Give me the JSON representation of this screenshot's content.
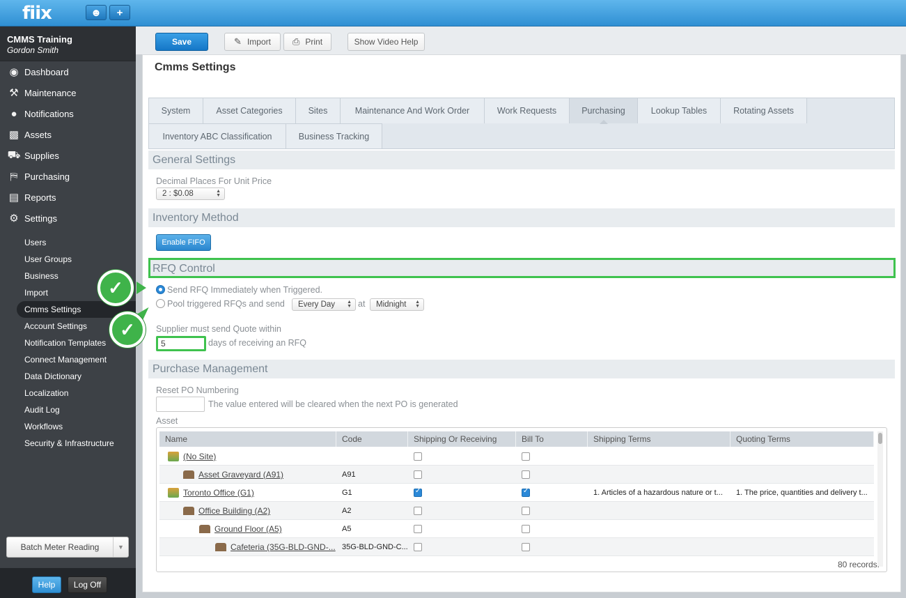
{
  "app": {
    "logo": "fiix"
  },
  "topbar": {
    "user_icon": "user-icon",
    "add_icon": "plus-icon"
  },
  "account": {
    "org": "CMMS Training",
    "user": "Gordon Smith"
  },
  "nav": [
    {
      "label": "Dashboard",
      "icon": "dashboard-icon"
    },
    {
      "label": "Maintenance",
      "icon": "tools-icon"
    },
    {
      "label": "Notifications",
      "icon": "chat-icon"
    },
    {
      "label": "Assets",
      "icon": "box-icon"
    },
    {
      "label": "Supplies",
      "icon": "truck-icon"
    },
    {
      "label": "Purchasing",
      "icon": "cart-icon"
    },
    {
      "label": "Reports",
      "icon": "chart-icon"
    },
    {
      "label": "Settings",
      "icon": "gear-icon"
    }
  ],
  "settings_sub": [
    "Users",
    "User Groups",
    "Business",
    "Import",
    "Cmms Settings",
    "Account Settings",
    "Notification Templates",
    "Connect Management",
    "Data Dictionary",
    "Localization",
    "Audit Log",
    "Workflows",
    "Security & Infrastructure"
  ],
  "sidebar_bottom": {
    "batch": "Batch Meter Reading",
    "help": "Help",
    "logoff": "Log Off"
  },
  "toolbar": {
    "save": "Save",
    "import": "Import",
    "print": "Print",
    "video": "Show Video Help"
  },
  "page_title": "Cmms Settings",
  "tabs_row1": [
    "System",
    "Asset Categories",
    "Sites",
    "Maintenance And Work Order",
    "Work Requests",
    "Purchasing",
    "Lookup Tables",
    "Rotating Assets"
  ],
  "tabs_row2": [
    "Inventory ABC Classification",
    "Business Tracking"
  ],
  "active_tab": "Purchasing",
  "general": {
    "heading": "General Settings",
    "decimal_label": "Decimal Places For Unit Price",
    "decimal_value": "2 : $0.08"
  },
  "inventory": {
    "heading": "Inventory Method",
    "fifo_button": "Enable FIFO"
  },
  "rfq": {
    "heading": "RFQ Control",
    "option1": "Send RFQ Immediately when Triggered.",
    "option2": "Pool triggered RFQs and send",
    "frequency": "Every Day",
    "at": "at",
    "time": "Midnight",
    "supplier_label": "Supplier must send Quote within",
    "days_value": "5",
    "days_suffix": "days of receiving an RFQ"
  },
  "purchase": {
    "heading": "Purchase Management",
    "reset_label": "Reset PO Numbering",
    "reset_hint": "The value entered will be cleared when the next PO is generated",
    "asset_label": "Asset"
  },
  "table": {
    "columns": [
      "Name",
      "Code",
      "Shipping Or Receiving",
      "Bill To",
      "Shipping Terms",
      "Quoting Terms"
    ],
    "rows": [
      {
        "name": "(No Site)",
        "code": "",
        "ship": false,
        "bill": false,
        "shipping_terms": "",
        "quoting_terms": ""
      },
      {
        "name": "Asset Graveyard (A91)",
        "code": "A91",
        "ship": false,
        "bill": false,
        "shipping_terms": "",
        "quoting_terms": ""
      },
      {
        "name": "Toronto Office (G1)",
        "code": "G1",
        "ship": true,
        "bill": true,
        "shipping_terms": "1. Articles of a hazardous nature or t...",
        "quoting_terms": "1. The price, quantities and delivery t..."
      },
      {
        "name": "Office Building (A2)",
        "code": "A2",
        "ship": false,
        "bill": false,
        "shipping_terms": "",
        "quoting_terms": ""
      },
      {
        "name": "Ground Floor (A5)",
        "code": "A5",
        "ship": false,
        "bill": false,
        "shipping_terms": "",
        "quoting_terms": ""
      },
      {
        "name": "Cafeteria (35G-BLD-GND-...",
        "code": "35G-BLD-GND-C...",
        "ship": false,
        "bill": false,
        "shipping_terms": "",
        "quoting_terms": ""
      }
    ],
    "records": "80 records."
  },
  "colors": {
    "accent": "#2f8fd3",
    "highlight": "#3fc24e"
  }
}
